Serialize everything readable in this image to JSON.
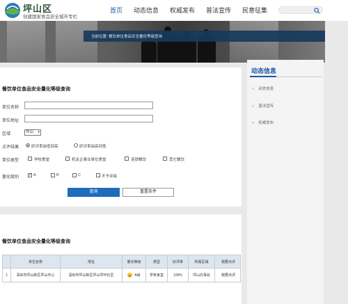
{
  "header": {
    "logo_title": "坪山区",
    "logo_subtitle": "创建国家食品安全城市专栏",
    "nav": [
      {
        "label": "首页",
        "active": true
      },
      {
        "label": "动态信息",
        "active": false
      },
      {
        "label": "权威发布",
        "active": false
      },
      {
        "label": "普法宣传",
        "active": false
      },
      {
        "label": "民意征集",
        "active": false
      }
    ],
    "search_placeholder": ""
  },
  "banner": {
    "breadcrumb": "当前位置: 餐饮单位食品安全量化等级查询"
  },
  "query_form": {
    "title": "餐饮单位食品安全量化等级查询",
    "name_label": "单位名称",
    "address_label": "单位地址",
    "region_label": "区域",
    "region_value": "坪山",
    "result_label": "点评结果",
    "result_options": [
      "好评率由低到高",
      "好评率由高到低"
    ],
    "result_selected_index": 0,
    "type_label": "单位类型",
    "type_options": [
      "学校食堂",
      "机关企事业单位食堂",
      "连锁餐饮",
      "其它餐饮"
    ],
    "level_label": "量化级别",
    "level_options": [
      "A",
      "B",
      "C",
      "不予评级"
    ],
    "level_checked": [
      true,
      false,
      false,
      false
    ],
    "query_button": "查询",
    "reset_button": "重置条件"
  },
  "results": {
    "title": "餐饮单位食品安全量化等级查询",
    "columns": [
      "",
      "单位名称",
      "地址",
      "量化等级",
      "类型",
      "好评率",
      "所属区域",
      "我要点评"
    ],
    "rows": [
      [
        "1",
        "深圳市坪山新区坪山中心",
        "深圳市坪山新区坪山坪环社区",
        "A级",
        "学校食堂",
        "100%",
        "坪山办事处",
        "我要点评"
      ]
    ]
  },
  "sidebar": {
    "title": "动态信息",
    "items": [
      "动态信息",
      "普法宣传",
      "权威发布"
    ]
  },
  "colors": {
    "accent": "#1b5aa6",
    "primary_button": "#1e6dbb"
  }
}
